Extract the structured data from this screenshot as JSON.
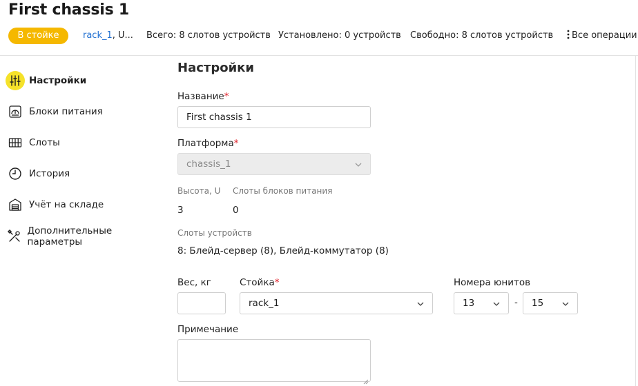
{
  "header": {
    "title": "First chassis 1",
    "status_badge": "В стойке",
    "rack_link": "rack_1",
    "rack_suffix": ", U...",
    "total": "Всего: 8 слотов устройств",
    "installed": "Установлено: 0 устройств",
    "free": "Свободно: 8 слотов устройств",
    "all_operations": "Все операции"
  },
  "sidebar": {
    "items": [
      {
        "label": "Настройки",
        "icon": "sliders-icon",
        "active": true
      },
      {
        "label": "Блоки питания",
        "icon": "power-supply-icon"
      },
      {
        "label": "Слоты",
        "icon": "slots-grid-icon"
      },
      {
        "label": "История",
        "icon": "clock-icon"
      },
      {
        "label": "Учёт на складе",
        "icon": "warehouse-icon"
      },
      {
        "label": "Дополнительные параметры",
        "icon": "tools-icon"
      }
    ]
  },
  "form": {
    "section_title": "Настройки",
    "name_label": "Название",
    "name_value": "First chassis 1",
    "platform_label": "Платформа",
    "platform_value": "chassis_1",
    "height_label": "Высота, U",
    "height_value": "3",
    "psu_slots_label": "Слоты блоков питания",
    "psu_slots_value": "0",
    "device_slots_label": "Слоты устройств",
    "device_slots_value": "8: Блейд-сервер (8), Блейд-коммутатор (8)",
    "weight_label": "Вес, кг",
    "weight_value": "",
    "rack_label": "Стойка",
    "rack_value": "rack_1",
    "units_label": "Номера юнитов",
    "unit_from": "13",
    "unit_to": "15",
    "units_separator": "-",
    "note_label": "Примечание",
    "note_value": "",
    "required_mark": "*"
  },
  "colors": {
    "badge": "#f5b800",
    "link": "#1f6fd1",
    "active_icon_bg": "#f5e22a",
    "required": "#e0202a"
  }
}
